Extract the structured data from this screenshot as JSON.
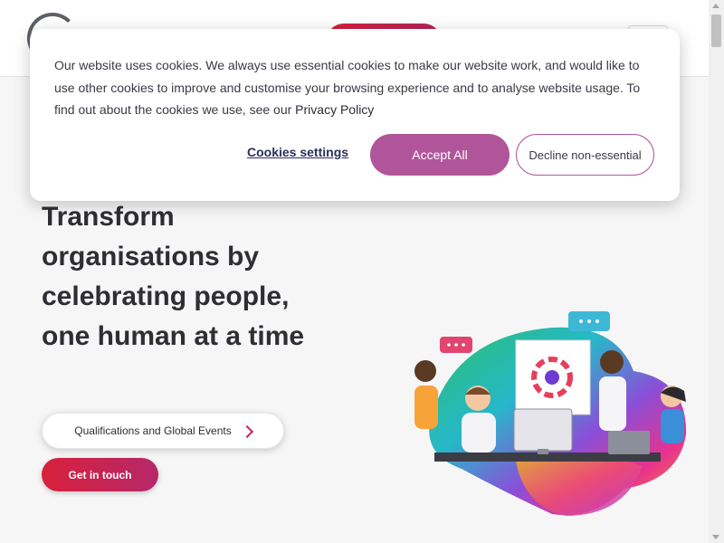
{
  "cookie_banner": {
    "text": "Our website uses cookies. We always use essential cookies to make our website work, and would like to use other cookies to improve and customise your browsing experience and to analyse website usage. To find out about the cookies we use, see our ",
    "privacy_link": "Privacy Policy",
    "settings_label": "Cookies settings",
    "accept_label": "Accept All",
    "decline_label": "Decline non-essential"
  },
  "hero": {
    "title": "Transform organisations by celebrating people, one human at a time",
    "qualifications_button": "Qualifications and Global Events",
    "contact_button": "Get in touch"
  },
  "icons": [
    "logo-icon",
    "menu-icon",
    "chevron-right-icon"
  ],
  "colors": {
    "accent": "#b1559b",
    "brand_red": "#d61f3c",
    "link_navy": "#2b2f5c"
  }
}
